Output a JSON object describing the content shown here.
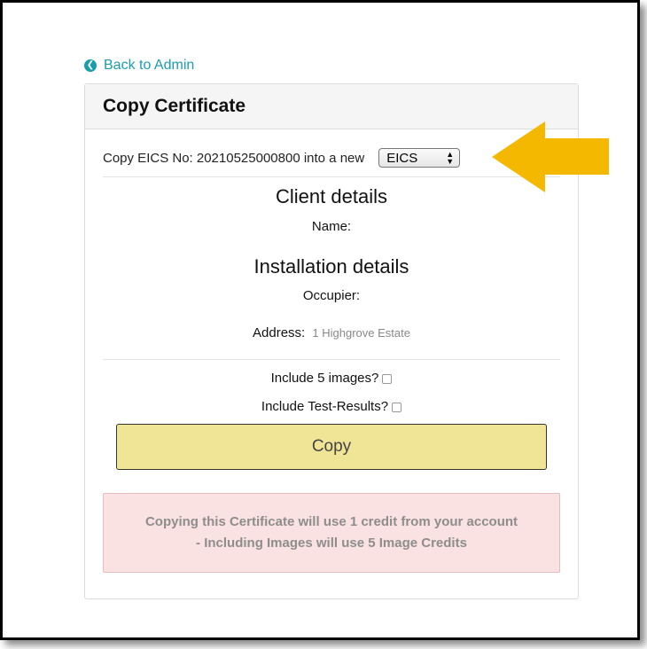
{
  "nav": {
    "back_label": "Back to Admin",
    "back_icon": "chevron-left-circle-icon"
  },
  "panel": {
    "title": "Copy Certificate"
  },
  "copy_row": {
    "text": "Copy EICS No: 20210525000800 into a new",
    "select_value": "EICS"
  },
  "client": {
    "heading": "Client details",
    "name_label": "Name:"
  },
  "installation": {
    "heading": "Installation details",
    "occupier_label": "Occupier:",
    "address_label": "Address:",
    "address_value": "1 Highgrove Estate"
  },
  "options": {
    "images_label": "Include 5 images?",
    "images_checked": false,
    "results_label": "Include Test-Results?",
    "results_checked": false
  },
  "actions": {
    "copy_label": "Copy"
  },
  "notice": {
    "line1": "Copying this Certificate will use 1 credit from your account",
    "line2": "- Including Images will use 5 Image Credits"
  },
  "colors": {
    "link": "#1a9dac",
    "button": "#f0e597",
    "alert_bg": "#fbe2e2",
    "arrow": "#f5b800"
  }
}
